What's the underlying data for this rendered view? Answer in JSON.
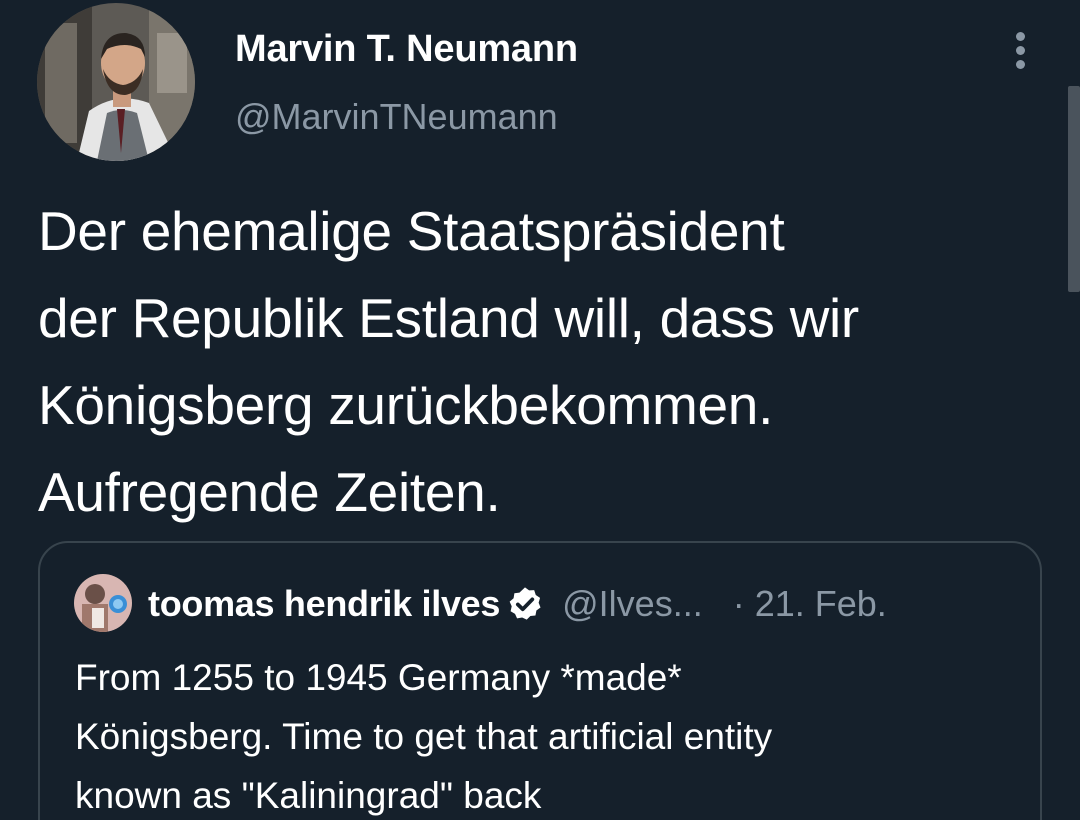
{
  "tweet": {
    "author_name": "Marvin T. Neumann",
    "author_handle": "@MarvinTNeumann",
    "text_lines": [
      "Der ehemalige Staatspräsident",
      "der Republik Estland will, dass wir",
      "Königsberg zurückbekommen.",
      "Aufregende Zeiten."
    ],
    "avatar_icon": "profile-photo-man-in-vest",
    "more_icon": "vertical-ellipsis-icon"
  },
  "quoted": {
    "author_name": "toomas hendrik ilves",
    "verified_icon": "verified-badge-icon",
    "author_handle": "@Ilves...",
    "separator": "·",
    "date": "21. Feb.",
    "text_lines": [
      "From 1255 to 1945 Germany *made*",
      "Königsberg. Time to get that artificial entity",
      "known as \"Kaliningrad\" back"
    ]
  },
  "colors": {
    "background": "#15202b",
    "primary_text": "#ffffff",
    "secondary_text": "#8b98a5",
    "border": "#38444d"
  }
}
